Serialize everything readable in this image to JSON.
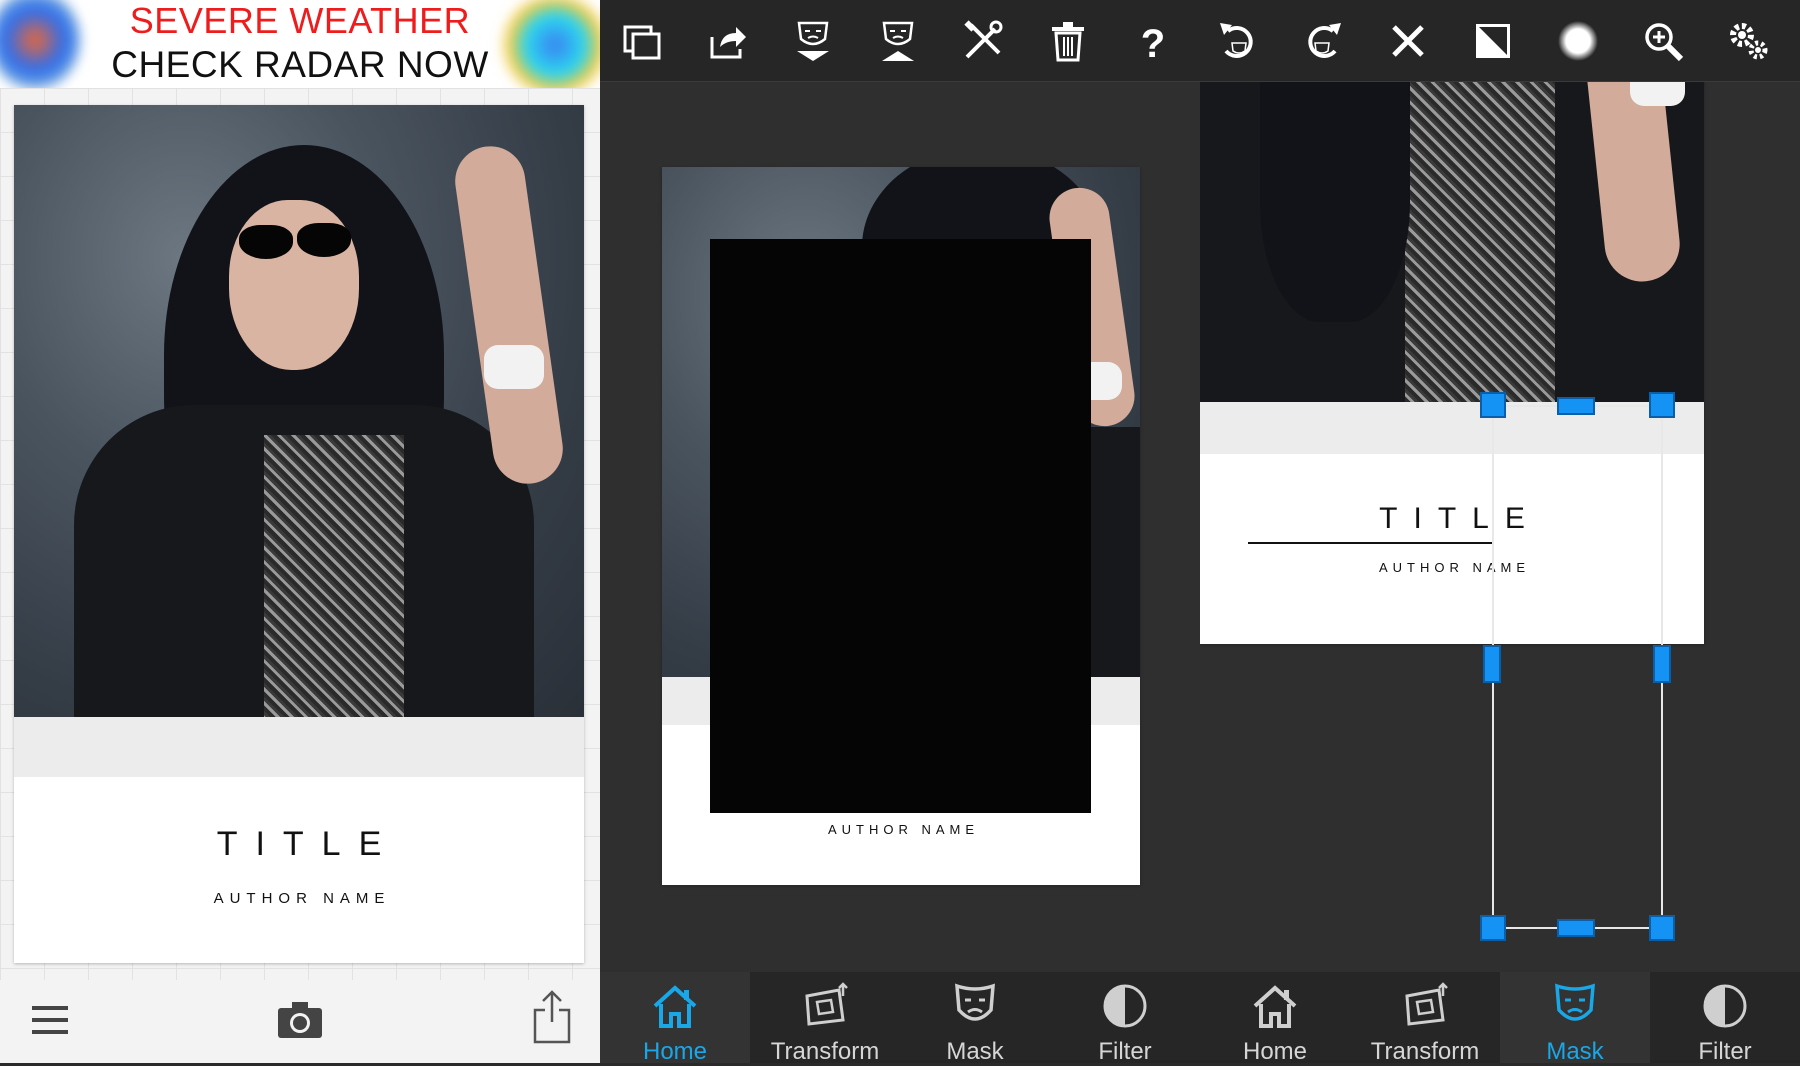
{
  "ad": {
    "line1": "SEVERE WEATHER",
    "line2": "CHECK RADAR NOW",
    "accent_color": "#ee1d1d"
  },
  "cover": {
    "title": "TITLE",
    "author": "AUTHOR NAME"
  },
  "left_toolbar": {
    "menu_icon": "hamburger-menu-icon",
    "camera_icon": "camera-icon",
    "share_icon": "share-icon"
  },
  "top_toolbar": {
    "buttons": [
      "duplicate-icon",
      "export-icon",
      "mask-down-icon",
      "mask-up-icon",
      "tools-icon",
      "trash-icon",
      "help-icon",
      "undo-icon",
      "redo-icon",
      "close-icon",
      "contrast-icon",
      "brush-dot-icon",
      "zoom-in-icon",
      "settings-icon"
    ]
  },
  "bottom_nav": {
    "tabs": [
      {
        "label": "Home",
        "icon": "home-icon",
        "active": true
      },
      {
        "label": "Transform",
        "icon": "transform-icon",
        "active": false
      },
      {
        "label": "Mask",
        "icon": "mask-icon",
        "active": false
      },
      {
        "label": "Filter",
        "icon": "filter-icon",
        "active": false
      },
      {
        "label": "Home",
        "icon": "home-icon",
        "active": false
      },
      {
        "label": "Transform",
        "icon": "transform-icon",
        "active": false
      },
      {
        "label": "Mask",
        "icon": "mask-icon",
        "active": true
      },
      {
        "label": "Filter",
        "icon": "filter-icon",
        "active": false
      }
    ],
    "active_color": "#1aa7e8"
  },
  "colors": {
    "handle": "#1593f5",
    "toolbar_bg": "#262626",
    "canvas_bg": "#2f2f2f"
  }
}
